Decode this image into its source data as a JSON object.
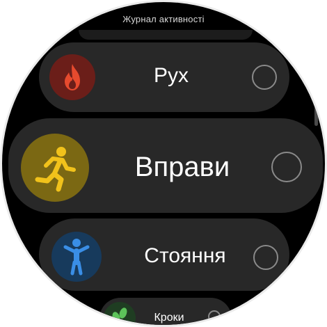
{
  "header": {
    "title": "Журнал активності"
  },
  "items": [
    {
      "label": "Рух",
      "icon": "flame-icon",
      "color": "#e64a2e",
      "checked": false
    },
    {
      "label": "Вправи",
      "icon": "running-icon",
      "color": "#f1c21b",
      "checked": false
    },
    {
      "label": "Стояння",
      "icon": "standing-person-icon",
      "color": "#3a8ee6",
      "checked": false
    },
    {
      "label": "Кроки",
      "icon": "footsteps-icon",
      "color": "#5cc35a",
      "checked": false
    }
  ]
}
